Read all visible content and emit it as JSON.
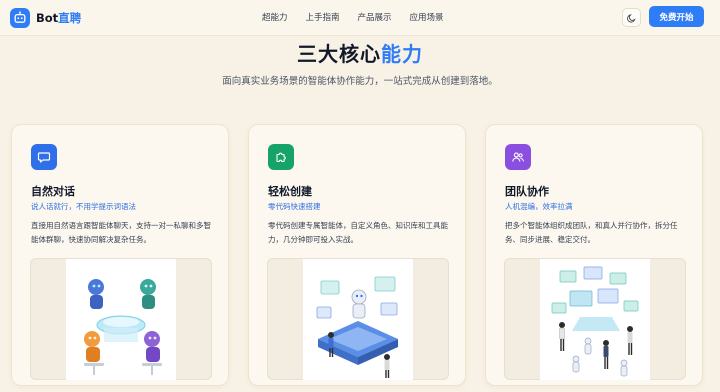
{
  "header": {
    "logo_text": "Bot",
    "logo_accent": "直聘",
    "nav": [
      "超能力",
      "上手指南",
      "产品展示",
      "应用场景"
    ],
    "theme_icon": "moon-icon",
    "cta_label": "免费开始"
  },
  "hero": {
    "title": "三大核心",
    "title_accent": "能力",
    "subtitle": "面向真实业务场景的智能体协作能力，一站式完成从创建到落地。"
  },
  "cards": [
    {
      "icon": "chat-bubble-icon",
      "icon_color": "#2f6fe8",
      "title": "自然对话",
      "tag": "说人话就行，不用学提示词语法",
      "desc": "直接用自然语言跟智能体聊天，支持一对一私聊和多智能体群聊，快速协同解决复杂任务。"
    },
    {
      "icon": "puzzle-icon",
      "icon_color": "#16a36a",
      "title": "轻松创建",
      "tag": "零代码快速搭建",
      "desc": "零代码创建专属智能体，自定义角色、知识库和工具能力，几分钟即可投入实战。"
    },
    {
      "icon": "team-icon",
      "icon_color": "#8b4fe0",
      "title": "团队协作",
      "tag": "人机混编，效率拉满",
      "desc": "把多个智能体组织成团队，和真人并行协作，拆分任务、同步进展、稳定交付。"
    }
  ],
  "colors": {
    "accent": "#2f7df6",
    "background": "#f8f2e6"
  }
}
